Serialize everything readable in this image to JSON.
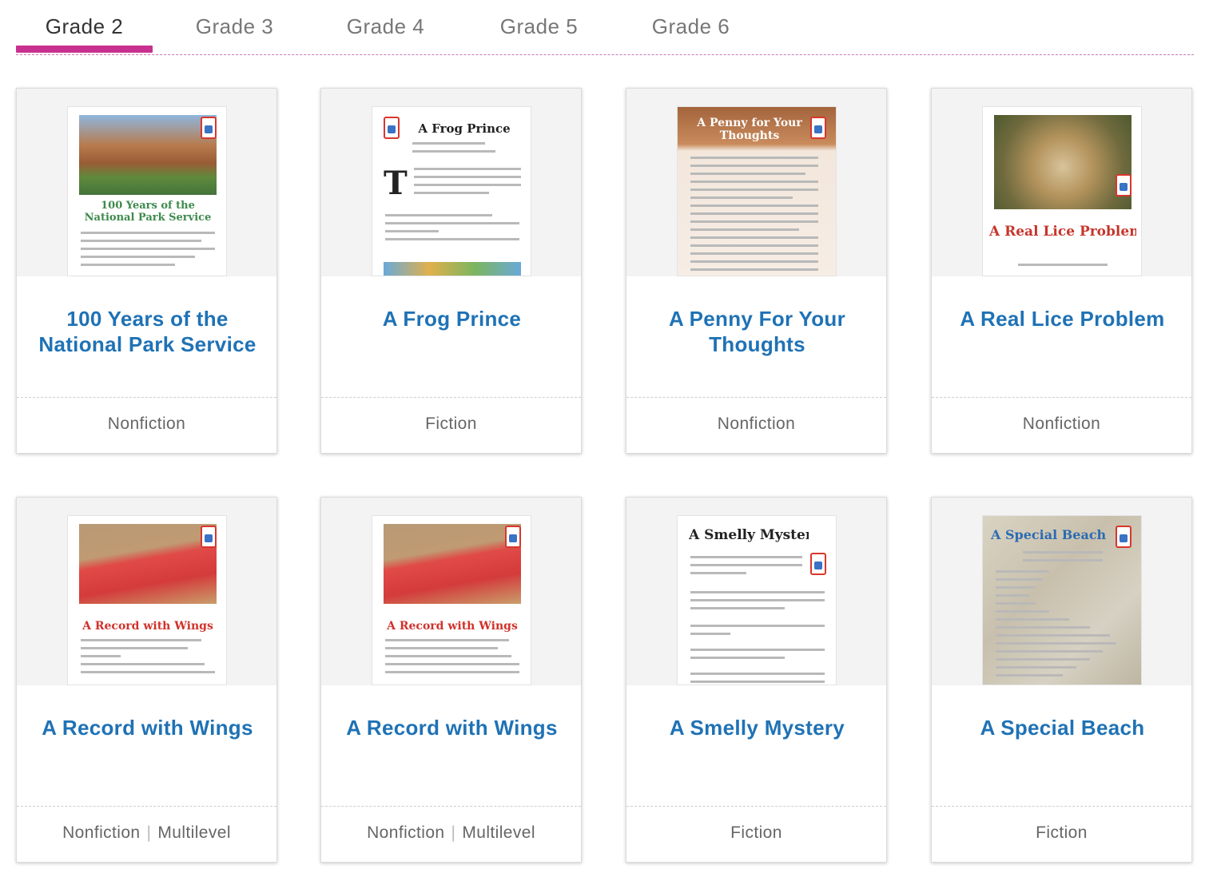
{
  "tabs": [
    "Grade 2",
    "Grade 3",
    "Grade 4",
    "Grade 5",
    "Grade 6"
  ],
  "active_tab": "Grade 2",
  "cards": [
    {
      "title": "100 Years of the National Park Service",
      "genre": "Nonfiction",
      "level": "",
      "thumb_title": "100 Years of the National Park Service"
    },
    {
      "title": "A Frog Prince",
      "genre": "Fiction",
      "level": "",
      "thumb_title": "A Frog Prince"
    },
    {
      "title": "A Penny For Your Thoughts",
      "genre": "Nonfiction",
      "level": "",
      "thumb_title": "A Penny for Your Thoughts"
    },
    {
      "title": "A Real Lice Problem",
      "genre": "Nonfiction",
      "level": "",
      "thumb_title": "A Real Lice Problem"
    },
    {
      "title": "A Record with Wings",
      "genre": "Nonfiction",
      "level": "Multilevel",
      "thumb_title": "A Record with Wings"
    },
    {
      "title": "A Record with Wings",
      "genre": "Nonfiction",
      "level": "Multilevel",
      "thumb_title": "A Record with Wings"
    },
    {
      "title": "A Smelly Mystery",
      "genre": "Fiction",
      "level": "",
      "thumb_title": "A Smelly Mystery"
    },
    {
      "title": "A Special Beach",
      "genre": "Fiction",
      "level": "",
      "thumb_title": "A Special Beach"
    }
  ],
  "colors": {
    "accent": "#c8318f",
    "link": "#1f72b5"
  }
}
